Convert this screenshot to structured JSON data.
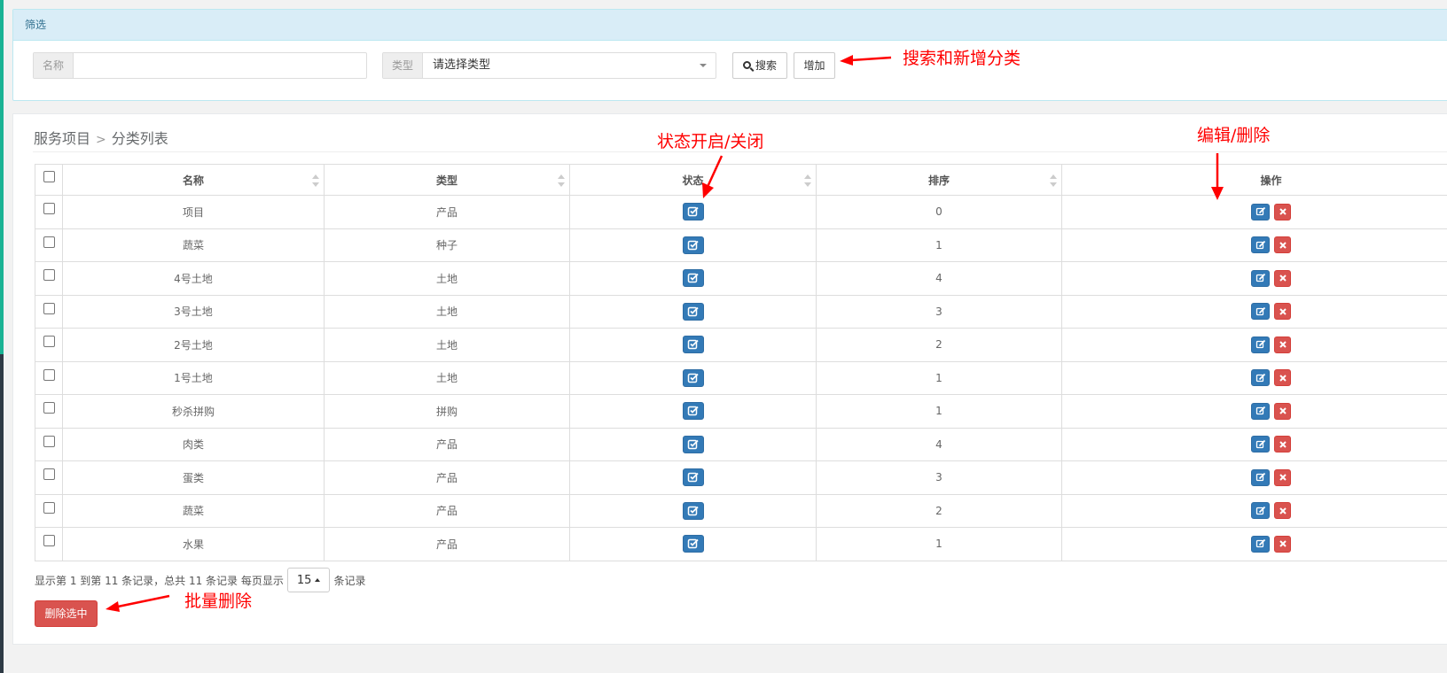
{
  "filter": {
    "heading": "筛选",
    "name_label": "名称",
    "name_value": "",
    "type_label": "类型",
    "type_selected": "请选择类型",
    "search_label": "搜索",
    "add_label": "增加"
  },
  "breadcrumb": {
    "parent": "服务项目",
    "separator": ">",
    "current": "分类列表"
  },
  "table": {
    "columns": [
      "名称",
      "类型",
      "状态",
      "排序",
      "操作"
    ],
    "rows": [
      {
        "name": "项目",
        "type": "产品",
        "status": "enabled",
        "sort": "0"
      },
      {
        "name": "蔬菜",
        "type": "种子",
        "status": "enabled",
        "sort": "1"
      },
      {
        "name": "4号土地",
        "type": "土地",
        "status": "enabled",
        "sort": "4"
      },
      {
        "name": "3号土地",
        "type": "土地",
        "status": "enabled",
        "sort": "3"
      },
      {
        "name": "2号土地",
        "type": "土地",
        "status": "enabled",
        "sort": "2"
      },
      {
        "name": "1号土地",
        "type": "土地",
        "status": "enabled",
        "sort": "1"
      },
      {
        "name": "秒杀拼购",
        "type": "拼购",
        "status": "enabled",
        "sort": "1"
      },
      {
        "name": "肉类",
        "type": "产品",
        "status": "enabled",
        "sort": "4"
      },
      {
        "name": "蛋类",
        "type": "产品",
        "status": "enabled",
        "sort": "3"
      },
      {
        "name": "蔬菜",
        "type": "产品",
        "status": "enabled",
        "sort": "2"
      },
      {
        "name": "水果",
        "type": "产品",
        "status": "enabled",
        "sort": "1"
      }
    ]
  },
  "pagination": {
    "info_prefix": "显示第 1 到第 11 条记录，总共 11 条记录 每页显示",
    "page_size": "15",
    "info_suffix": "条记录"
  },
  "batch_delete_label": "删除选中",
  "annotations": {
    "search_add": "搜索和新增分类",
    "status_toggle": "状态开启/关闭",
    "edit_delete": "编辑/删除",
    "batch_delete": "批量删除"
  },
  "icons": {
    "status": "check-square-icon",
    "edit": "edit-icon",
    "delete": "close-icon",
    "search": "search-icon",
    "caret": "caret-down-icon"
  },
  "colors": {
    "primary": "#337ab7",
    "danger": "#d9534f",
    "info_bg": "#d9edf7",
    "annotation": "#ff0000"
  }
}
